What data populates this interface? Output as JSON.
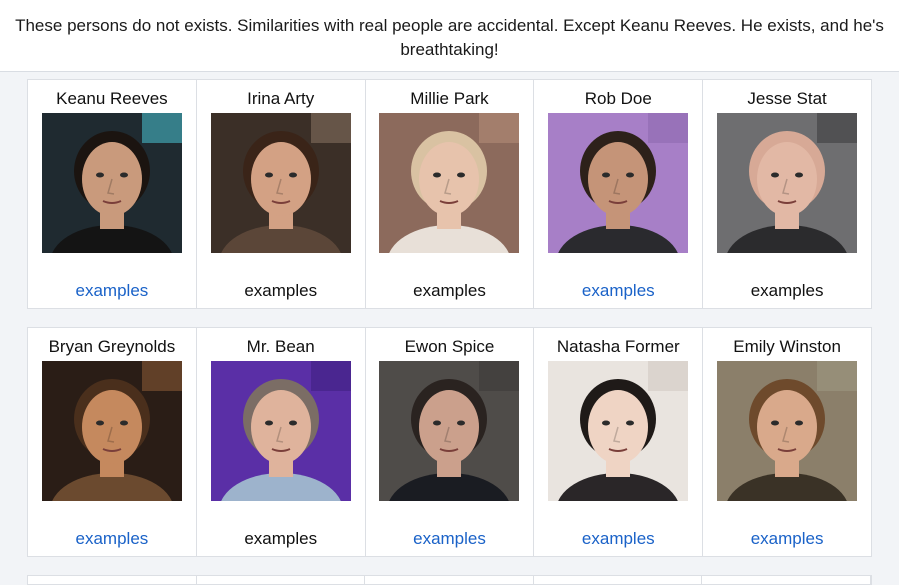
{
  "banner": {
    "text": "These persons do not exists. Similarities with real people are accidental. Except Keanu Reeves. He exists, and he's breathtaking!"
  },
  "rows": [
    [
      {
        "name": "Keanu Reeves",
        "examples": "examples",
        "examples_is_link": true,
        "bg": "#1f2a30",
        "skin": "#c99a7c",
        "hair": "#1b1410",
        "shirt": "#141414",
        "accent": "#49c3d3"
      },
      {
        "name": "Irina Arty",
        "examples": "examples",
        "examples_is_link": false,
        "bg": "#3b2f27",
        "skin": "#d3a184",
        "hair": "#3a2418",
        "shirt": "#5b4638",
        "accent": "#8a7464"
      },
      {
        "name": "Millie Park",
        "examples": "examples",
        "examples_is_link": false,
        "bg": "#8c6a5c",
        "skin": "#e7c3ac",
        "hair": "#d9c2a2",
        "shirt": "#e8e0d8",
        "accent": "#b78e7a"
      },
      {
        "name": "Rob Doe",
        "examples": "examples",
        "examples_is_link": true,
        "bg": "#a77fc7",
        "skin": "#c59478",
        "hair": "#2d211a",
        "shirt": "#2a2a2e",
        "accent": "#8c67ad"
      },
      {
        "name": "Jesse Stat",
        "examples": "examples",
        "examples_is_link": false,
        "bg": "#6e6e70",
        "skin": "#e2b8a5",
        "hair": "#d7a996",
        "shirt": "#2b2b2d",
        "accent": "#3a3a3c"
      }
    ],
    [
      {
        "name": "Bryan Greynolds",
        "examples": "examples",
        "examples_is_link": true,
        "bg": "#2a1d16",
        "skin": "#c5895e",
        "hair": "#4a2f1c",
        "shirt": "#6b4a2f",
        "accent": "#8e5c38"
      },
      {
        "name": "Mr. Bean",
        "examples": "examples",
        "examples_is_link": false,
        "bg": "#5a2fa6",
        "skin": "#dfb39c",
        "hair": "#7b6d65",
        "shirt": "#9db3cc",
        "accent": "#3e1f7d"
      },
      {
        "name": "Ewon Spice",
        "examples": "examples",
        "examples_is_link": true,
        "bg": "#4f4c49",
        "skin": "#cba08c",
        "hair": "#2a2320",
        "shirt": "#1a1c22",
        "accent": "#3d3936"
      },
      {
        "name": "Natasha Former",
        "examples": "examples",
        "examples_is_link": true,
        "bg": "#e9e4df",
        "skin": "#efd4c4",
        "hair": "#1f1a18",
        "shirt": "#2a2628",
        "accent": "#cfc7c0"
      },
      {
        "name": "Emily Winston",
        "examples": "examples",
        "examples_is_link": true,
        "bg": "#8b7f6a",
        "skin": "#d9a98b",
        "hair": "#6e4a2c",
        "shirt": "#3a3226",
        "accent": "#a09a84"
      }
    ]
  ]
}
